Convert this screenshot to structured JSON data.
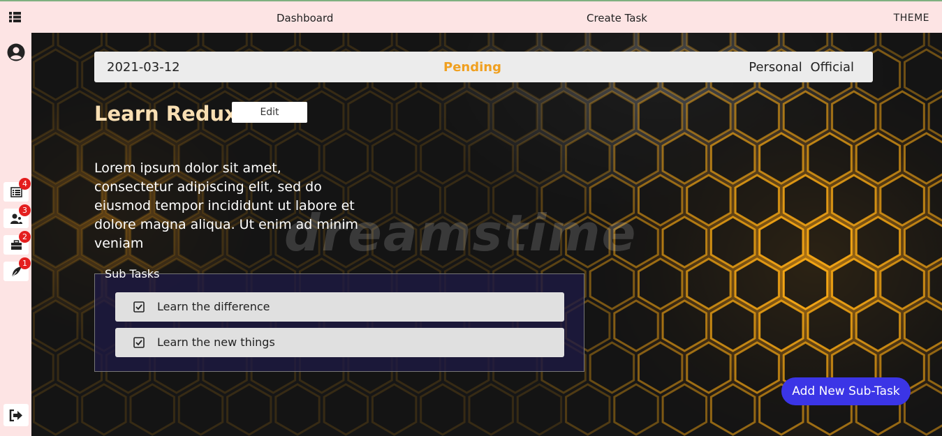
{
  "topbar": {
    "menu_icon": "grid-list-icon",
    "nav": {
      "dashboard": "Dashboard",
      "create_task": "Create Task"
    },
    "theme": "THEME"
  },
  "sidebar": {
    "avatar_icon": "user-circle-icon",
    "items": [
      {
        "icon": "list-icon",
        "badge": "4"
      },
      {
        "icon": "users-icon",
        "badge": "3"
      },
      {
        "icon": "briefcase-icon",
        "badge": "2"
      },
      {
        "icon": "feather-icon",
        "badge": "1"
      }
    ],
    "logout_icon": "sign-out-icon"
  },
  "task": {
    "date": "2021-03-12",
    "status": "Pending",
    "categories": [
      "Personal",
      "Official"
    ],
    "title": "Learn Redux",
    "edit_label": "Edit",
    "description": "Lorem ipsum dolor sit amet, consectetur adipiscing elit, sed do eiusmod tempor incididunt ut labore et dolore magna aliqua. Ut enim ad minim veniam",
    "subtasks_legend": "Sub Tasks",
    "subtasks": [
      {
        "label": "Learn the difference",
        "checked": true
      },
      {
        "label": "Learn the new things",
        "checked": true
      }
    ],
    "add_subtask_label": "Add New Sub-Task"
  },
  "background": {
    "watermark": "dreamstime"
  },
  "colors": {
    "topbar_bg": "#fde4e4",
    "status": "#f0a020",
    "title": "#f9dfb3",
    "badge": "#e41e1e",
    "add_button": "#3b35e6"
  }
}
